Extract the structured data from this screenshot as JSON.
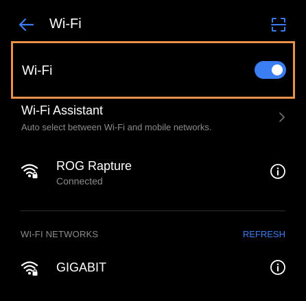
{
  "header": {
    "title": "Wi-Fi",
    "back_icon": "back-arrow-icon",
    "scan_icon": "qr-scan-icon"
  },
  "wifi_toggle": {
    "label": "Wi-Fi",
    "enabled": true
  },
  "assistant": {
    "title": "Wi-Fi Assistant",
    "subtitle": "Auto select between Wi-Fi and mobile networks."
  },
  "connected_network": {
    "name": "ROG Rapture",
    "status": "Connected"
  },
  "networks_section": {
    "label": "WI-FI NETWORKS",
    "refresh_label": "REFRESH"
  },
  "networks": [
    {
      "name": "GIGABIT"
    }
  ],
  "colors": {
    "accent": "#3b7df2",
    "highlight_border": "#e8924a",
    "background": "#000000",
    "secondary_text": "#8c8c8c"
  }
}
